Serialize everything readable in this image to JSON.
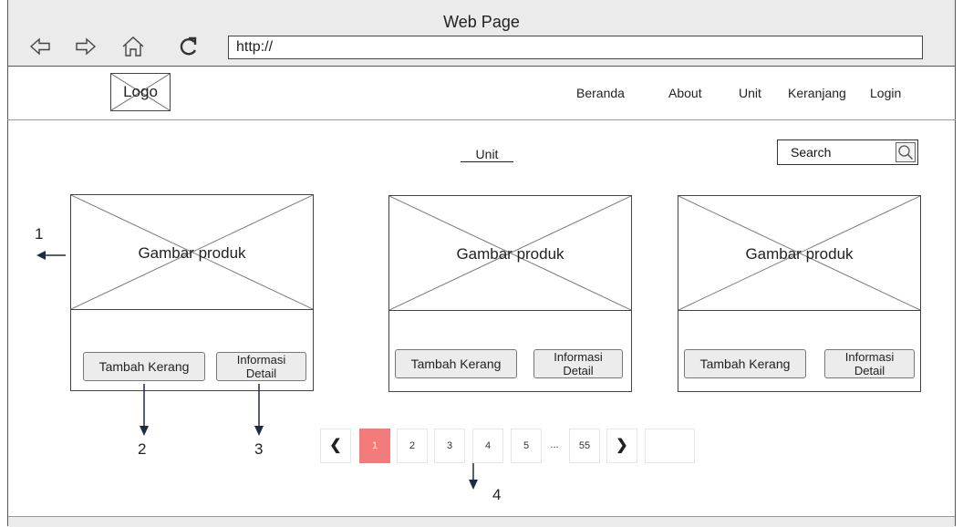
{
  "window": {
    "title": "Web Page"
  },
  "browser": {
    "url": "http://"
  },
  "header": {
    "logo": "Logo",
    "nav": [
      "Beranda",
      "About",
      "Unit",
      "Keranjang",
      "Login"
    ]
  },
  "main": {
    "title": "Unit",
    "search": {
      "placeholder": "Search"
    },
    "products": [
      {
        "image_label": "Gambar produk",
        "add_button": "Tambah Kerang",
        "detail_line1": "Informasi",
        "detail_line2": "Detail"
      },
      {
        "image_label": "Gambar produk",
        "add_button": "Tambah Kerang",
        "detail_line1": "Informasi",
        "detail_line2": "Detail"
      },
      {
        "image_label": "Gambar produk",
        "add_button": "Tambah Kerang",
        "detail_line1": "Informasi",
        "detail_line2": "Detail"
      }
    ],
    "pagination": {
      "prev": "❮",
      "pages": [
        "1",
        "2",
        "3",
        "4",
        "5"
      ],
      "ellipsis": "...",
      "last": "55",
      "next": "❯",
      "active_page": "1"
    }
  },
  "annotations": [
    "1",
    "2",
    "3",
    "4"
  ],
  "colors": {
    "active_page": "#f47b7b",
    "chrome": "#ebebeb",
    "button": "#ececec"
  },
  "icons": [
    "back-arrow-icon",
    "forward-arrow-icon",
    "home-icon",
    "refresh-icon",
    "search-icon"
  ]
}
